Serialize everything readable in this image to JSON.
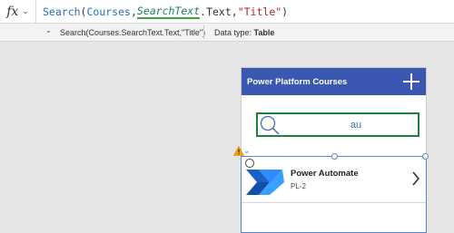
{
  "formula_bar": {
    "fx_label": "fx",
    "fx_chevron": "⌄",
    "formula": {
      "func": "Search",
      "open_paren": "(",
      "collection": "Courses",
      "comma1": ",",
      "control": "SearchText",
      "property": ".Text",
      "comma2": ",",
      "column_string": "\"Title\"",
      "close_paren": ")"
    }
  },
  "hint_bar": {
    "chevron": "⌄",
    "expression": "Search(Courses.SearchText.Text,\"Title\")",
    "data_type_label": "Data type:",
    "data_type_value": "Table"
  },
  "app": {
    "header_title": "Power Platform Courses",
    "search_value": "au",
    "gallery": {
      "items": [
        {
          "title": "Power Automate",
          "subtitle": "PL-2"
        }
      ]
    },
    "warning_chevron": "⌄"
  },
  "colors": {
    "header_bg": "#3a58b2",
    "search_border": "#1f7f3c",
    "selection": "#5a86c4",
    "warning": "#f2a900"
  },
  "icons": [
    "fx-icon",
    "chevron-down-icon",
    "add-icon",
    "search-icon",
    "warning-icon",
    "edit-icon",
    "power-automate-logo",
    "chevron-right-icon"
  ]
}
